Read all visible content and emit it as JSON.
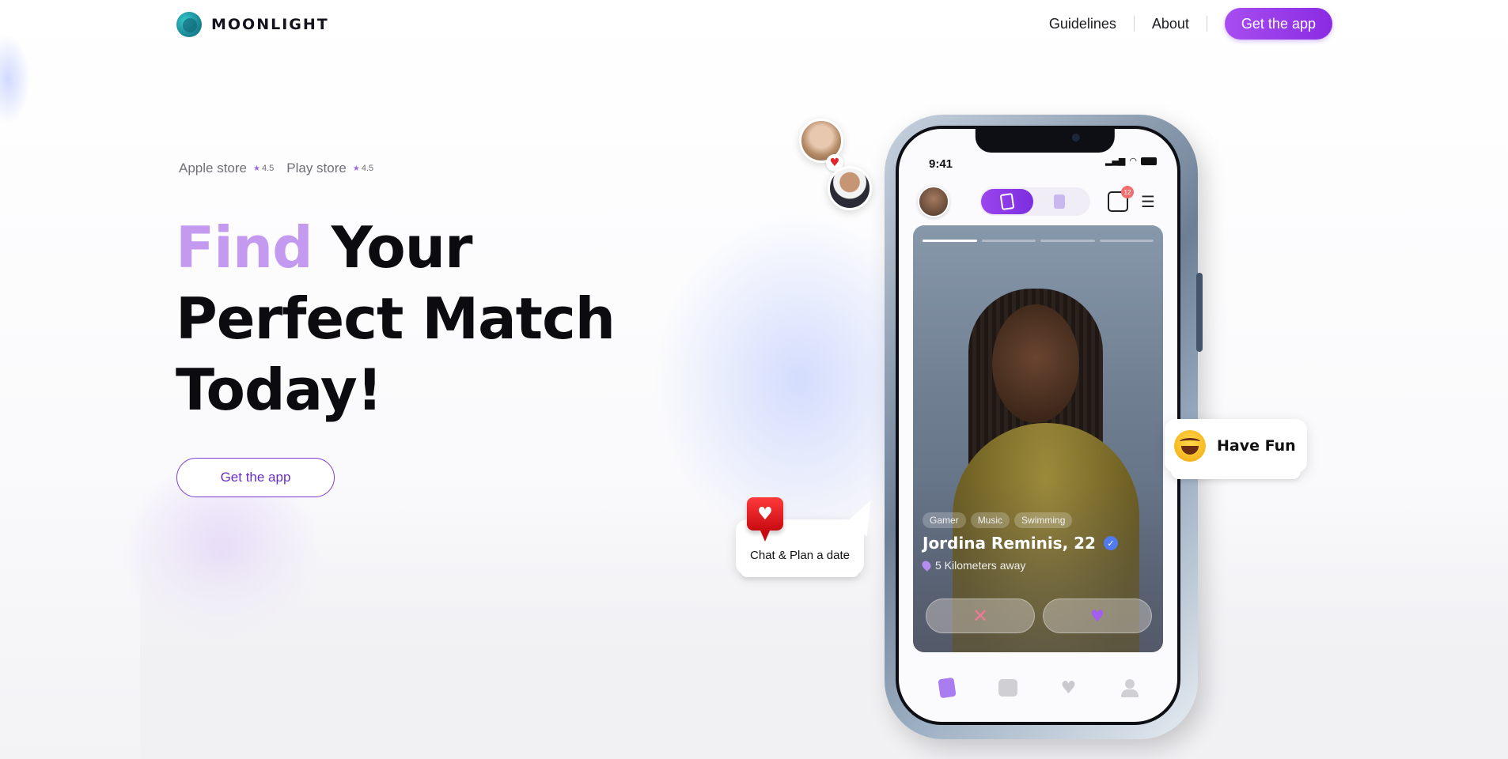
{
  "brand": {
    "name": "MOONLIGHT",
    "accent": "#8a2be2",
    "accent_light": "#c39af0"
  },
  "nav": {
    "links": [
      "Guidelines",
      "About"
    ],
    "cta": "Get the app"
  },
  "ratings": [
    {
      "store": "Apple store",
      "score": "4.5"
    },
    {
      "store": "Play store",
      "score": "4.5"
    }
  ],
  "hero": {
    "headline_accent": "Find",
    "headline_line1_rest": " Your",
    "headline_line2": "Perfect Match",
    "headline_line3": "Today!",
    "cta": "Get the app"
  },
  "phone": {
    "time": "9:41",
    "unread_count": "12",
    "profile": {
      "tags": [
        "Gamer",
        "Music",
        "Swimming"
      ],
      "name": "Jordina Reminis, 22",
      "distance": "5 Kilometers away"
    }
  },
  "bubbles": {
    "chat": "Chat & Plan a date",
    "fun": "Have Fun"
  }
}
